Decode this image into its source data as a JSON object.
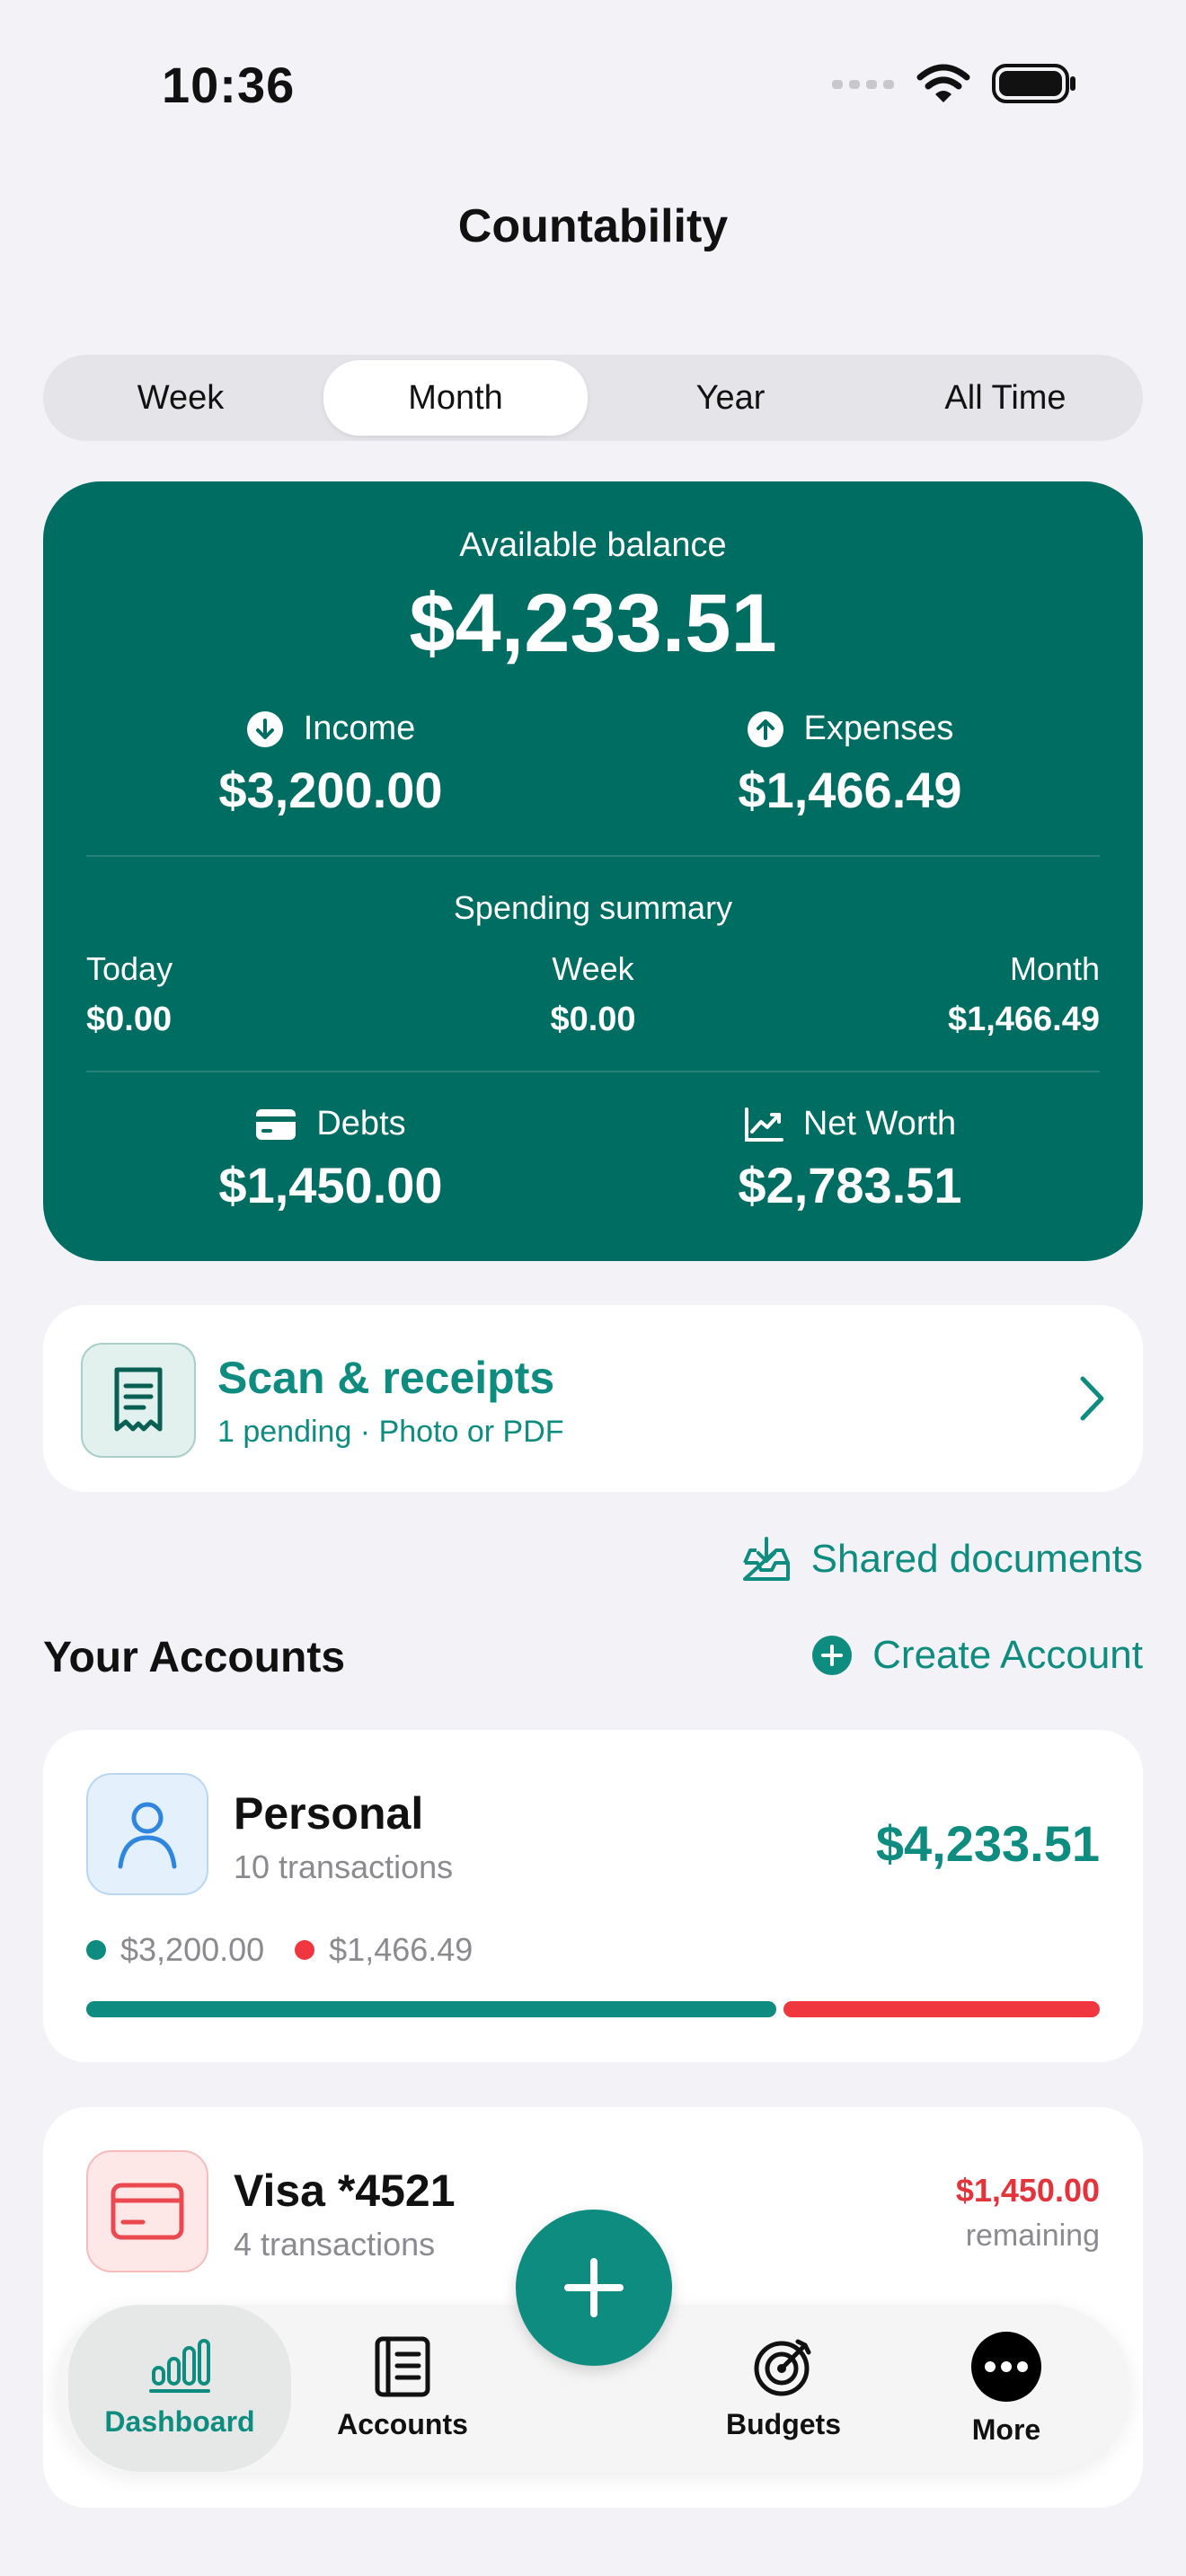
{
  "status_bar": {
    "time": "10:36"
  },
  "nav": {
    "title": "Countability"
  },
  "period_tabs": [
    {
      "label": "Week",
      "active": false
    },
    {
      "label": "Month",
      "active": true
    },
    {
      "label": "Year",
      "active": false
    },
    {
      "label": "All Time",
      "active": false
    }
  ],
  "balance": {
    "label": "Available balance",
    "amount": "$4,233.51",
    "income_label": "Income",
    "income": "$3,200.00",
    "expenses_label": "Expenses",
    "expenses": "$1,466.49",
    "spending_title": "Spending summary",
    "spending": [
      {
        "label": "Today",
        "value": "$0.00"
      },
      {
        "label": "Week",
        "value": "$0.00"
      },
      {
        "label": "Month",
        "value": "$1,466.49"
      }
    ],
    "debts_label": "Debts",
    "debts": "$1,450.00",
    "networth_label": "Net Worth",
    "networth": "$2,783.51"
  },
  "scan": {
    "title": "Scan & receipts",
    "subtitle": "1 pending · Photo or PDF"
  },
  "shared_documents": "Shared documents",
  "accounts_section": {
    "title": "Your Accounts",
    "create_label": "Create Account"
  },
  "accounts": [
    {
      "name": "Personal",
      "subtitle": "10 transactions",
      "amount": "$4,233.51",
      "income": "$3,200.00",
      "expense": "$1,466.49",
      "income_share": 0.686
    },
    {
      "name": "Visa *4521",
      "subtitle": "4 transactions",
      "amount": "$1,450.00",
      "amount_note": "remaining"
    }
  ],
  "tabbar": {
    "items": [
      {
        "label": "Dashboard",
        "active": true
      },
      {
        "label": "Accounts",
        "active": false
      },
      {
        "label": "Budgets",
        "active": false
      },
      {
        "label": "More",
        "active": false
      }
    ]
  },
  "colors": {
    "brand": "#006d62",
    "accent": "#0e8c7f",
    "expense": "#f0373f",
    "background": "#f2f2f7"
  }
}
